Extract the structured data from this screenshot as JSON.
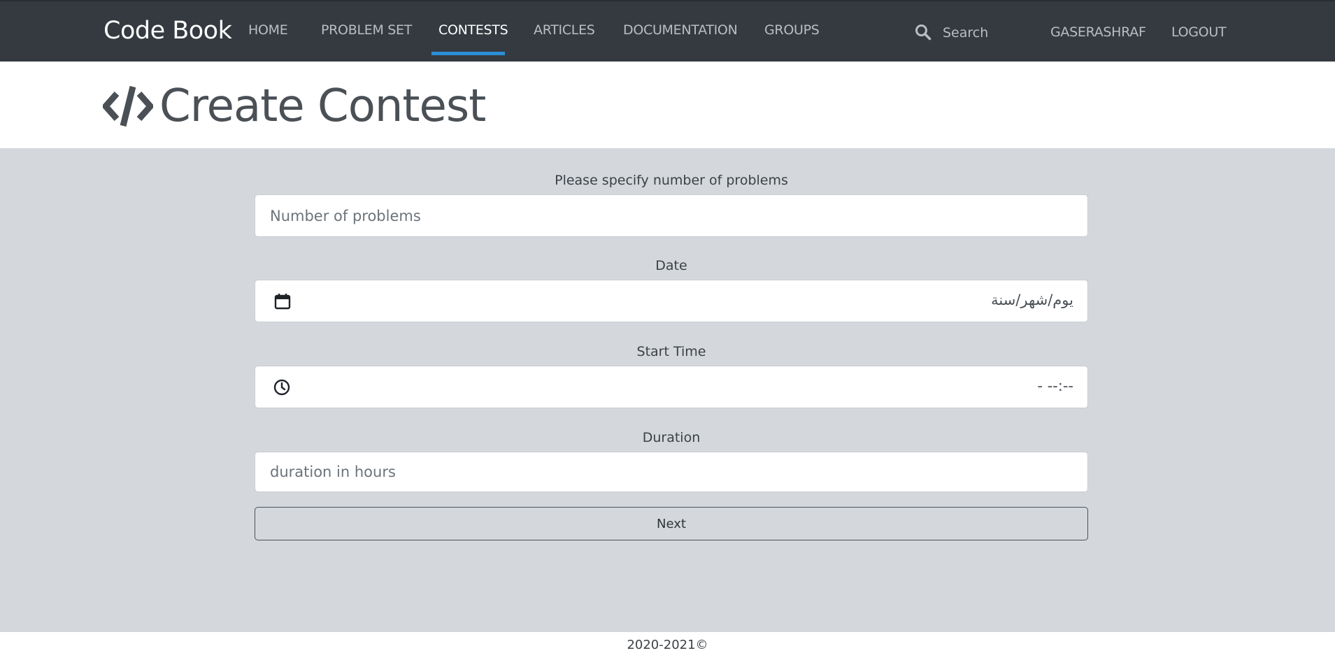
{
  "colors": {
    "navbar_bg": "#343a40",
    "active_underline": "#2b8fd6",
    "page_bg": "#d4d8dc",
    "title_color": "#4a5056"
  },
  "navbar": {
    "brand": "Code Book",
    "links": [
      {
        "label": "HOME",
        "active": false
      },
      {
        "label": "PROBLEM SET",
        "active": false
      },
      {
        "label": "CONTESTS",
        "active": true
      },
      {
        "label": "ARTICLES",
        "active": false
      },
      {
        "label": "DOCUMENTATION",
        "active": false
      },
      {
        "label": "GROUPS",
        "active": false
      }
    ],
    "search": {
      "placeholder": "Search",
      "icon": "search-icon"
    },
    "user": "GASERASHRAF",
    "logout": "LOGOUT"
  },
  "header": {
    "icon": "code-icon",
    "title": "Create Contest"
  },
  "form": {
    "problems": {
      "label": "Please specify number of problems",
      "placeholder": "Number of problems"
    },
    "date": {
      "label": "Date",
      "value": "يوم/شهر/سنة",
      "icon": "calendar-icon"
    },
    "start_time": {
      "label": "Start Time",
      "value": "--:-- -",
      "icon": "clock-icon"
    },
    "duration": {
      "label": "Duration",
      "placeholder": "duration in hours"
    },
    "next_label": "Next"
  },
  "footer": {
    "text": "2020-2021©"
  }
}
